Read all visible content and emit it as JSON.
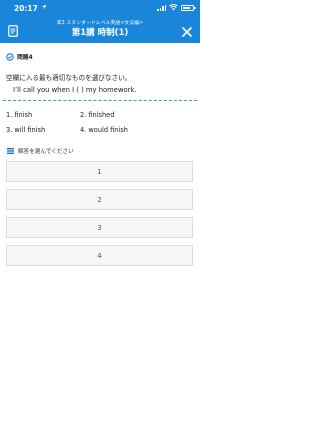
{
  "status_bar": {
    "time": "20:17"
  },
  "header": {
    "subtitle": "高3 スタンダードレベル英語<文法編>",
    "title": "第1講 時制(1)",
    "menu_icon": "document-icon",
    "close_icon": "close-icon"
  },
  "question": {
    "label": "問題4",
    "prompt": "空欄に入る最も適切なものを選びなさい。",
    "sentence": "I’ll call you when I (     ) my homework.",
    "choices": [
      "1. finish",
      "2. finished",
      "3. will finish",
      "4. would finish"
    ]
  },
  "answer": {
    "title": "解答を選んでください",
    "options": [
      "1",
      "2",
      "3",
      "4"
    ]
  },
  "colors": {
    "header_blue": "#1a86d9",
    "accent_blue": "#1a73c9",
    "option_bg": "#f7f7f7",
    "option_border": "#dcdcdc"
  }
}
